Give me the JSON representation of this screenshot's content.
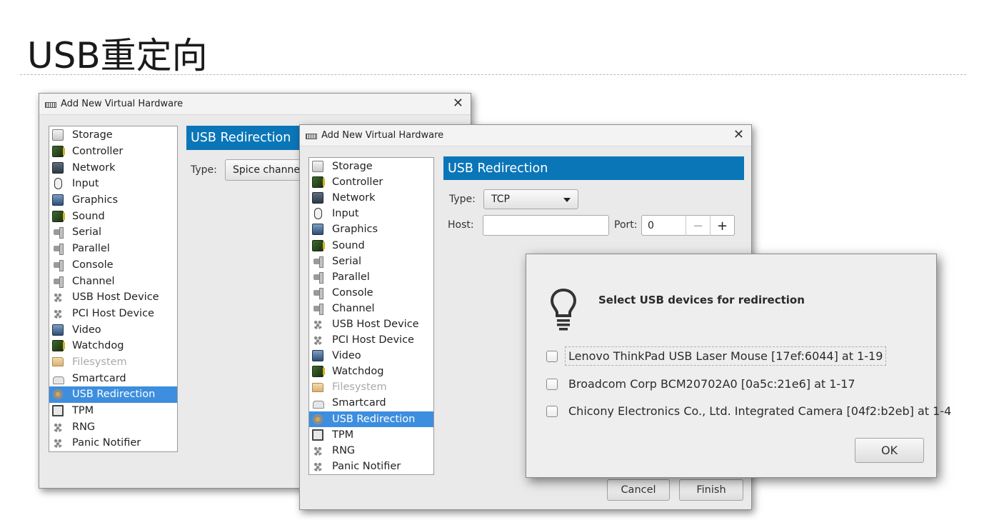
{
  "slide": {
    "title": "USB重定向"
  },
  "back_window": {
    "title": "Add New Virtual Hardware",
    "close_glyph": "✕",
    "section_title": "USB Redirection",
    "type_label": "Type:",
    "type_value": "Spice channe",
    "items": [
      {
        "label": "Storage",
        "icon": "disk-icon"
      },
      {
        "label": "Controller",
        "icon": "controller-icon"
      },
      {
        "label": "Network",
        "icon": "network-icon"
      },
      {
        "label": "Input",
        "icon": "mouse-icon"
      },
      {
        "label": "Graphics",
        "icon": "monitor-icon"
      },
      {
        "label": "Sound",
        "icon": "sound-card-icon"
      },
      {
        "label": "Serial",
        "icon": "plug-icon"
      },
      {
        "label": "Parallel",
        "icon": "plug-icon"
      },
      {
        "label": "Console",
        "icon": "plug-icon"
      },
      {
        "label": "Channel",
        "icon": "plug-icon"
      },
      {
        "label": "USB Host Device",
        "icon": "device-tree-icon"
      },
      {
        "label": "PCI Host Device",
        "icon": "device-tree-icon"
      },
      {
        "label": "Video",
        "icon": "monitor-icon"
      },
      {
        "label": "Watchdog",
        "icon": "watchdog-icon"
      },
      {
        "label": "Filesystem",
        "icon": "folder-icon",
        "disabled": true
      },
      {
        "label": "Smartcard",
        "icon": "smartcard-icon"
      },
      {
        "label": "USB Redirection",
        "icon": "usb-icon",
        "selected": true
      },
      {
        "label": "TPM",
        "icon": "chip-icon"
      },
      {
        "label": "RNG",
        "icon": "device-tree-icon"
      },
      {
        "label": "Panic Notifier",
        "icon": "device-tree-icon"
      }
    ]
  },
  "front_window": {
    "title": "Add New Virtual Hardware",
    "close_glyph": "✕",
    "section_title": "USB Redirection",
    "type_label": "Type:",
    "type_value": "TCP",
    "host_label": "Host:",
    "host_value": "",
    "port_label": "Port:",
    "port_value": "0",
    "minus": "−",
    "plus": "+",
    "cancel_label": "Cancel",
    "finish_label": "Finish",
    "items": [
      {
        "label": "Storage",
        "icon": "disk-icon"
      },
      {
        "label": "Controller",
        "icon": "controller-icon"
      },
      {
        "label": "Network",
        "icon": "network-icon"
      },
      {
        "label": "Input",
        "icon": "mouse-icon"
      },
      {
        "label": "Graphics",
        "icon": "monitor-icon"
      },
      {
        "label": "Sound",
        "icon": "sound-card-icon"
      },
      {
        "label": "Serial",
        "icon": "plug-icon"
      },
      {
        "label": "Parallel",
        "icon": "plug-icon"
      },
      {
        "label": "Console",
        "icon": "plug-icon"
      },
      {
        "label": "Channel",
        "icon": "plug-icon"
      },
      {
        "label": "USB Host Device",
        "icon": "device-tree-icon"
      },
      {
        "label": "PCI Host Device",
        "icon": "device-tree-icon"
      },
      {
        "label": "Video",
        "icon": "monitor-icon"
      },
      {
        "label": "Watchdog",
        "icon": "watchdog-icon"
      },
      {
        "label": "Filesystem",
        "icon": "folder-icon",
        "disabled": true
      },
      {
        "label": "Smartcard",
        "icon": "smartcard-icon"
      },
      {
        "label": "USB Redirection",
        "icon": "usb-icon",
        "selected": true
      },
      {
        "label": "TPM",
        "icon": "chip-icon"
      },
      {
        "label": "RNG",
        "icon": "device-tree-icon"
      },
      {
        "label": "Panic Notifier",
        "icon": "device-tree-icon"
      }
    ]
  },
  "usb_dialog": {
    "icon": "lightbulb-icon",
    "heading": "Select USB devices for redirection",
    "devices": [
      {
        "label": "Lenovo ThinkPad USB Laser Mouse [17ef:6044] at 1-19",
        "checked": false,
        "focused": true
      },
      {
        "label": "Broadcom Corp BCM20702A0 [0a5c:21e6] at 1-17",
        "checked": false
      },
      {
        "label": "Chicony Electronics Co., Ltd. Integrated Camera [04f2:b2eb] at 1-4",
        "checked": false
      }
    ],
    "ok_label": "OK"
  },
  "colors": {
    "section_header": "#0a76b8",
    "selection": "#3d8ede"
  }
}
